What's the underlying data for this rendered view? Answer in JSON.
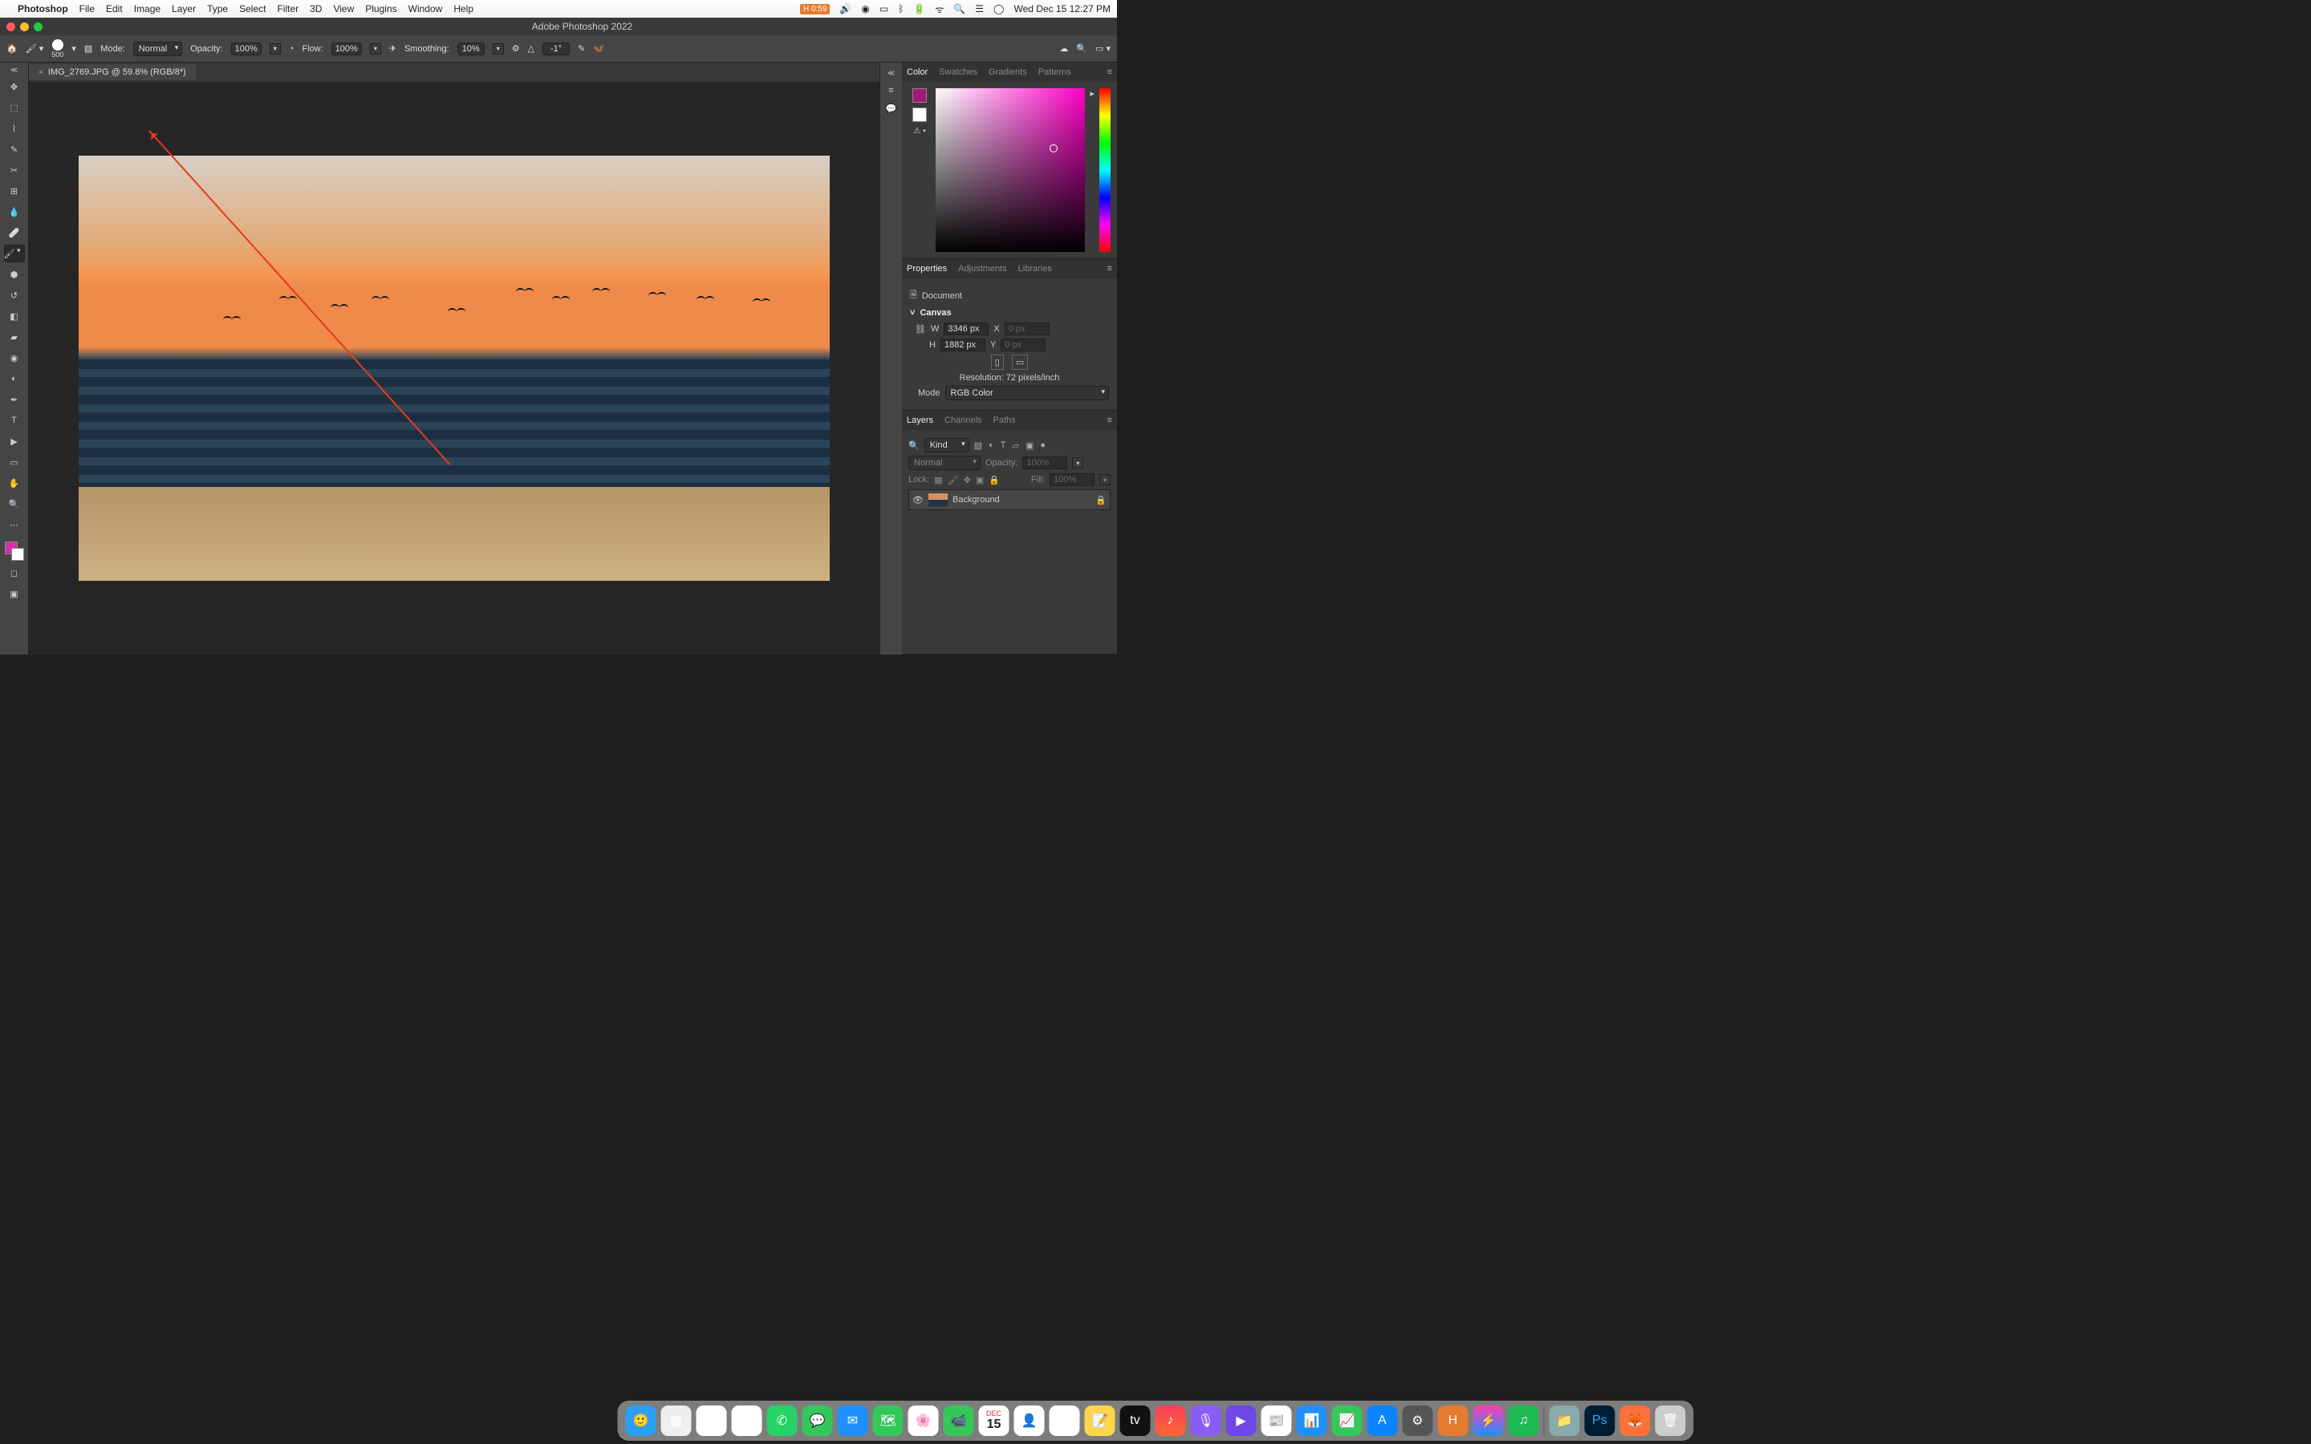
{
  "menubar": {
    "apple": "",
    "app": "Photoshop",
    "items": [
      "File",
      "Edit",
      "Image",
      "Layer",
      "Type",
      "Select",
      "Filter",
      "3D",
      "View",
      "Plugins",
      "Window",
      "Help"
    ],
    "rec_label": "H",
    "rec_time": "0:59",
    "clock": "Wed Dec 15  12:27 PM"
  },
  "window": {
    "title": "Adobe Photoshop 2022"
  },
  "options": {
    "brush_size": "500",
    "mode_label": "Mode:",
    "mode_value": "Normal",
    "opacity_label": "Opacity:",
    "opacity_value": "100%",
    "flow_label": "Flow:",
    "flow_value": "100%",
    "smoothing_label": "Smoothing:",
    "smoothing_value": "10%",
    "angle_value": "-1°"
  },
  "document": {
    "tab": "IMG_2769.JPG @ 59.8% (RGB/8*)"
  },
  "color_panel": {
    "tabs": [
      "Color",
      "Swatches",
      "Gradients",
      "Patterns"
    ],
    "fg": "#a31977",
    "bg": "#ffffff"
  },
  "properties_panel": {
    "tabs": [
      "Properties",
      "Adjustments",
      "Libraries"
    ],
    "doc_label": "Document",
    "section": "Canvas",
    "w_label": "W",
    "w_value": "3346 px",
    "h_label": "H",
    "h_value": "1882 px",
    "x_label": "X",
    "x_value": "0 px",
    "y_label": "Y",
    "y_value": "0 px",
    "res_label": "Resolution: 72 pixels/inch",
    "mode_label": "Mode",
    "mode_value": "RGB Color"
  },
  "layers_panel": {
    "tabs": [
      "Layers",
      "Channels",
      "Paths"
    ],
    "kind_label": "Kind",
    "blend": "Normal",
    "opacity_label": "Opacity:",
    "opacity_value": "100%",
    "lock_label": "Lock:",
    "fill_label": "Fill:",
    "fill_value": "100%",
    "layer_name": "Background"
  },
  "dock": {
    "cal_month": "DEC",
    "cal_day": "15"
  }
}
